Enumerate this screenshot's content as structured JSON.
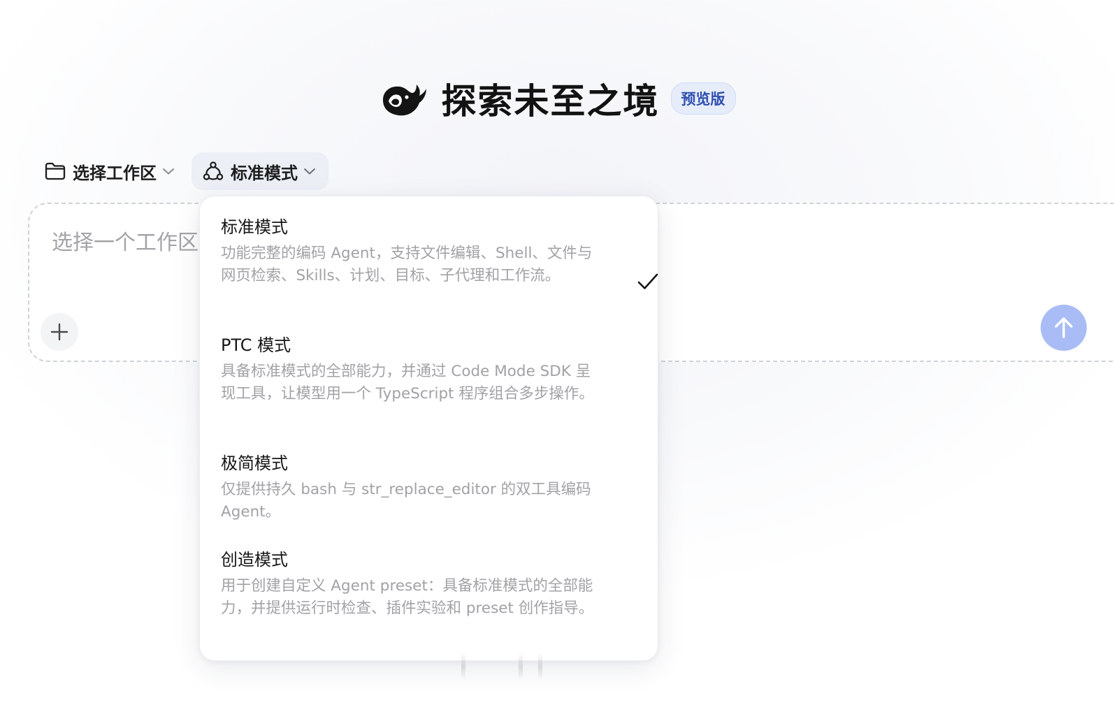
{
  "header": {
    "title": "探索未至之境",
    "badge": "预览版"
  },
  "toolbar": {
    "workspace_label": "选择工作区",
    "mode_label": "标准模式"
  },
  "input": {
    "placeholder": "选择一个工作区"
  },
  "dropdown": {
    "options": [
      {
        "title": "标准模式",
        "description": "功能完整的编码 Agent，支持文件编辑、Shell、文件与网页检索、Skills、计划、目标、子代理和工作流。",
        "selected": true
      },
      {
        "title": "PTC 模式",
        "description": "具备标准模式的全部能力，并通过 Code Mode SDK 呈现工具，让模型用一个 TypeScript 程序组合多步操作。",
        "selected": false
      },
      {
        "title": "极简模式",
        "description": "仅提供持久 bash 与 str_replace_editor 的双工具编码 Agent。",
        "selected": false
      },
      {
        "title": "创造模式",
        "description": "用于创建自定义 Agent preset：具备标准模式的全部能力，并提供运行时检查、插件实验和 preset 创作指导。",
        "selected": false
      }
    ]
  },
  "colors": {
    "badge_bg": "#e6ecfa",
    "badge_text": "#2f4fae",
    "send_button": "#a9bcf5",
    "mode_button_bg": "#eceff5"
  },
  "icons": {
    "logo": "whale-logo-icon",
    "workspace": "folder-icon",
    "mode": "nodes-icon",
    "chevron": "chevron-down-icon",
    "add": "plus-icon",
    "send": "arrow-up-icon",
    "check": "check-icon"
  }
}
